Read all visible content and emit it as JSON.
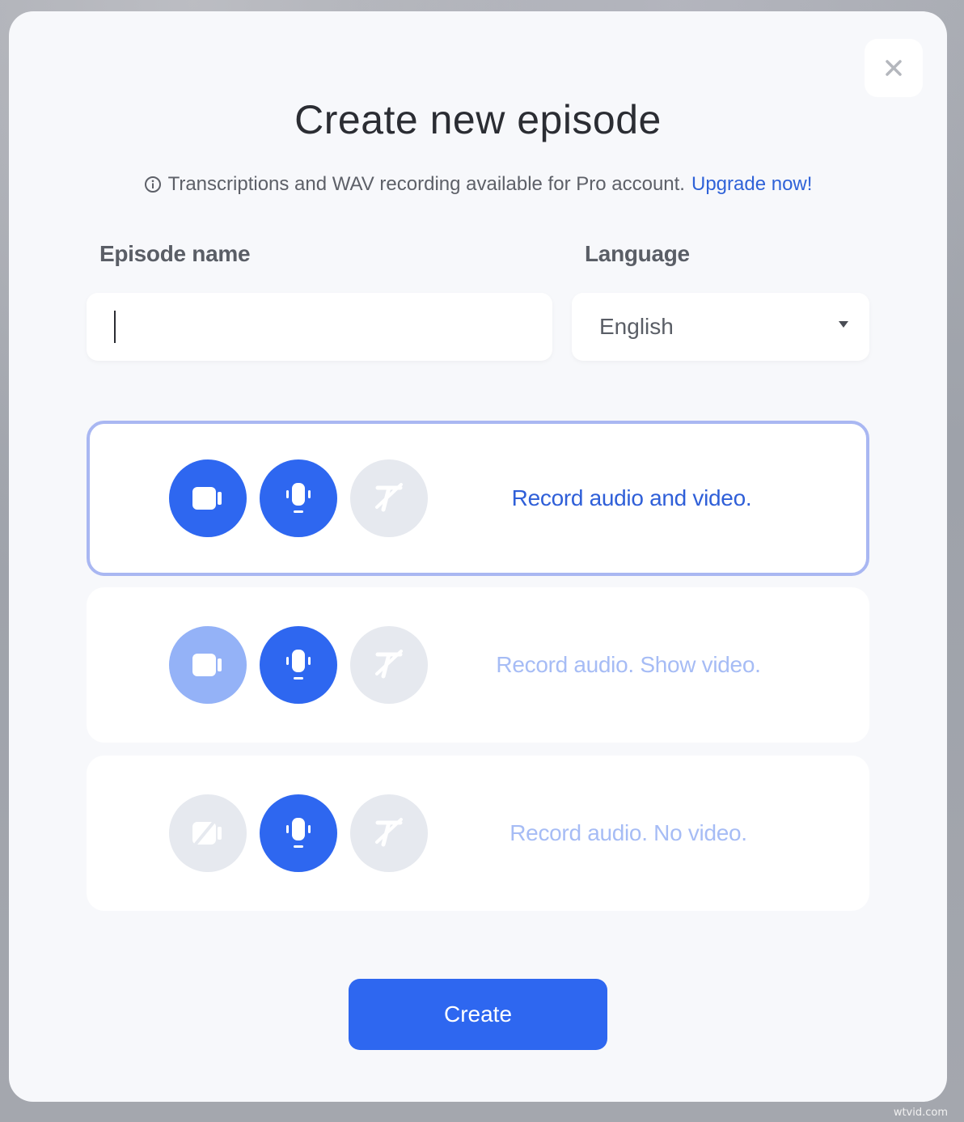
{
  "modal": {
    "title": "Create new episode",
    "notice_text": "Transcriptions and WAV recording available for Pro account.",
    "upgrade_link": "Upgrade now!",
    "close_icon": "close-icon"
  },
  "form": {
    "episode_name_label": "Episode name",
    "episode_name_value": "",
    "language_label": "Language",
    "language_value": "English"
  },
  "options": [
    {
      "label": "Record audio and video.",
      "selected": true,
      "label_color": "#2f5fd8",
      "icons": [
        {
          "name": "video-camera-icon",
          "state": "on"
        },
        {
          "name": "microphone-icon",
          "state": "on"
        },
        {
          "name": "transcription-off-icon",
          "state": "off"
        }
      ]
    },
    {
      "label": "Record audio. Show video.",
      "selected": false,
      "label_color": "#a6bcf5",
      "icons": [
        {
          "name": "video-camera-icon",
          "state": "partial"
        },
        {
          "name": "microphone-icon",
          "state": "on"
        },
        {
          "name": "transcription-off-icon",
          "state": "off"
        }
      ]
    },
    {
      "label": "Record audio. No video.",
      "selected": false,
      "label_color": "#a6bcf5",
      "icons": [
        {
          "name": "video-camera-off-icon",
          "state": "off"
        },
        {
          "name": "microphone-icon",
          "state": "on"
        },
        {
          "name": "transcription-off-icon",
          "state": "off"
        }
      ]
    }
  ],
  "actions": {
    "create_label": "Create"
  },
  "colors": {
    "accent": "#2e67f0",
    "accent_light": "#94b2f7",
    "disabled": "#e6e9ef",
    "selected_border": "#a9b7f2",
    "link": "#2f62d8"
  },
  "watermark": "wtvid.com"
}
